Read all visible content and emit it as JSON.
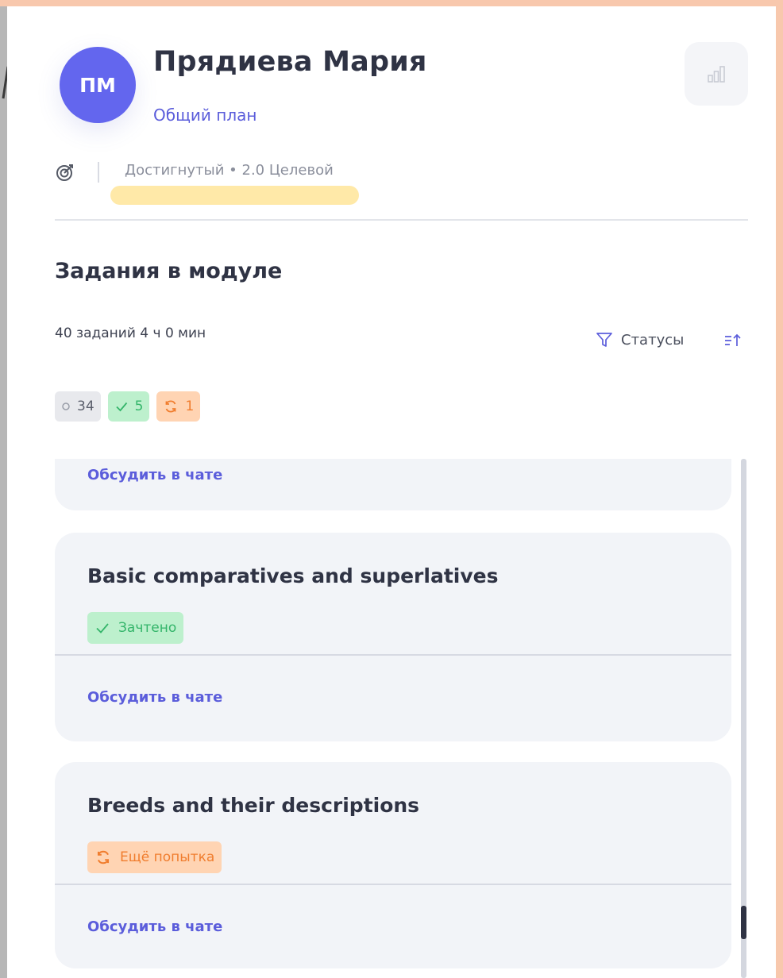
{
  "profile": {
    "initials": "ПМ",
    "name": "Прядиева Мария",
    "plan_link": "Общий план"
  },
  "goal": {
    "text": "Достигнутый • 2.0 Целевой"
  },
  "module": {
    "title": "Задания в модуле",
    "summary": "40 заданий 4 ч 0 мин",
    "filter_label": "Статусы",
    "counts": {
      "pending": "34",
      "done": "5",
      "retry": "1"
    }
  },
  "tasks": [
    {
      "chat_link": "Обсудить в чате"
    },
    {
      "title": "Basic comparatives and superlatives",
      "status": "Зачтено",
      "chat_link": "Обсудить в чате"
    },
    {
      "title": "Breeds and their descriptions",
      "status": "Ещё попытка",
      "chat_link": "Обсудить в чате"
    }
  ],
  "colors": {
    "accent": "#6366ee",
    "link": "#5b5ddb",
    "success": "#34b56a",
    "warning": "#f07d2e",
    "highlight": "#ffe9a8"
  },
  "icons": [
    "target-icon",
    "bar-chart-icon",
    "filter-icon",
    "sort-icon",
    "check-icon",
    "refresh-icon",
    "circle-icon"
  ]
}
